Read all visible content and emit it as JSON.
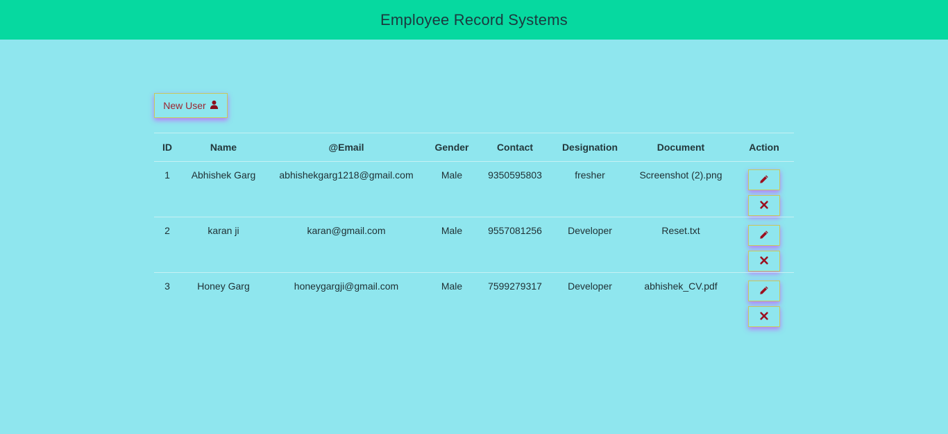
{
  "header": {
    "title": "Employee Record Systems"
  },
  "toolbar": {
    "new_user_label": "New User",
    "new_user_icon": "user-icon"
  },
  "table": {
    "columns": [
      "ID",
      "Name",
      "@Email",
      "Gender",
      "Contact",
      "Designation",
      "Document",
      "Action"
    ],
    "rows": [
      {
        "id": "1",
        "name": "Abhishek Garg",
        "email": "abhishekgarg1218@gmail.com",
        "gender": "Male",
        "contact": "9350595803",
        "designation": "fresher",
        "document": "Screenshot (2).png"
      },
      {
        "id": "2",
        "name": "karan ji",
        "email": "karan@gmail.com",
        "gender": "Male",
        "contact": "9557081256",
        "designation": "Developer",
        "document": "Reset.txt"
      },
      {
        "id": "3",
        "name": "Honey Garg",
        "email": "honeygargji@gmail.com",
        "gender": "Male",
        "contact": "7599279317",
        "designation": "Developer",
        "document": "abhishek_CV.pdf"
      }
    ],
    "action_icons": {
      "edit": "pencil-icon",
      "delete": "close-icon"
    }
  },
  "colors": {
    "header_bg": "#06d9a0",
    "page_bg": "#8fe6ee",
    "accent_icon": "#9c1020",
    "button_shadow": "#c850ff"
  }
}
